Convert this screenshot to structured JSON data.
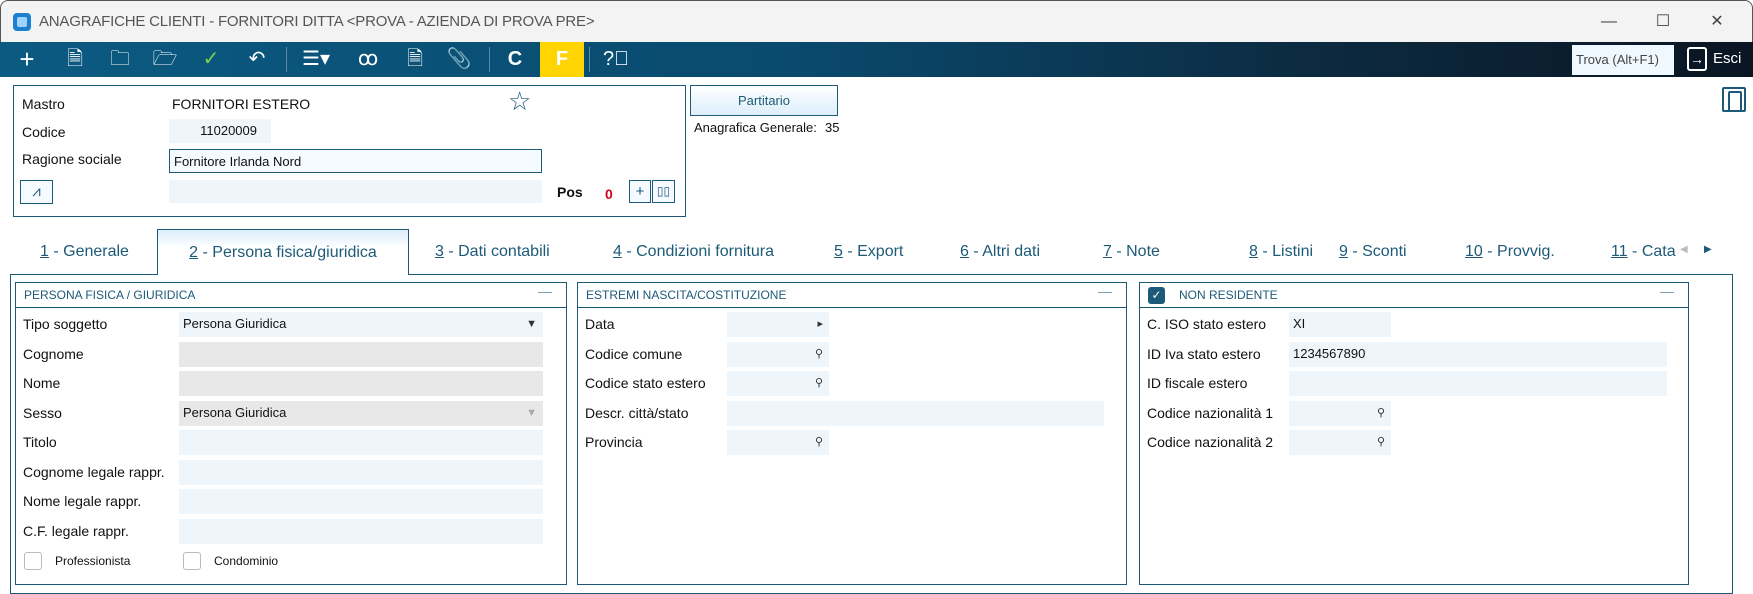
{
  "window": {
    "title": "ANAGRAFICHE CLIENTI - FORNITORI DITTA <PROVA - AZIENDA DI PROVA PRE>",
    "minimize": "—",
    "maximize": "☐",
    "close": "✕"
  },
  "toolbar": {
    "icons": [
      "plus-icon",
      "document-icon",
      "folder-open-icon",
      "folder-clock-icon",
      "check-icon",
      "undo-icon",
      "menu-dropdown-icon",
      "contacts-icon",
      "report-icon",
      "paperclip-icon",
      "c-icon",
      "f-icon",
      "help-icon"
    ],
    "c_label": "C",
    "f_label": "F",
    "search_label": "Trova (Alt+F1)",
    "exit_label": "Esci",
    "f_color": "#ffd400"
  },
  "header": {
    "mastro_label": "Mastro",
    "mastro_value": "FORNITORI ESTERO",
    "codice_label": "Codice",
    "codice_value": "11020009",
    "ragione_label": "Ragione sociale",
    "ragione_value": "Fornitore Irlanda Nord",
    "pos_label": "Pos",
    "pos_value": "0",
    "partitario_label": "Partitario",
    "anagrafica_label": "Anagrafica Generale:",
    "anagrafica_value": "35"
  },
  "tabs": [
    {
      "key": "1",
      "label": " - Generale"
    },
    {
      "key": "2",
      "label": " - Persona fisica/giuridica",
      "active": true
    },
    {
      "key": "3",
      "label": " - Dati contabili"
    },
    {
      "key": "4",
      "label": " - Condizioni fornitura"
    },
    {
      "key": "5",
      "label": " - Export"
    },
    {
      "key": "6",
      "label": " - Altri dati"
    },
    {
      "key": "7",
      "label": " - Note"
    },
    {
      "key": "8",
      "label": " - Listini"
    },
    {
      "key": "9",
      "label": " - Sconti"
    },
    {
      "key": "10",
      "label": " - Provvig."
    },
    {
      "key": "11",
      "label": " - Cata"
    }
  ],
  "panel_persona": {
    "title": "PERSONA FISICA / GIURIDICA",
    "rows": [
      {
        "label": "Tipo soggetto",
        "value": "Persona Giuridica"
      },
      {
        "label": "Cognome",
        "value": ""
      },
      {
        "label": "Nome",
        "value": ""
      },
      {
        "label": "Sesso",
        "value": "Persona Giuridica"
      },
      {
        "label": "Titolo",
        "value": ""
      },
      {
        "label": "Cognome legale rappr.",
        "value": ""
      },
      {
        "label": "Nome legale rappr.",
        "value": ""
      },
      {
        "label": "C.F. legale rappr.",
        "value": ""
      }
    ],
    "professionista": "Professionista",
    "condominio": "Condominio"
  },
  "panel_nascita": {
    "title": "ESTREMI NASCITA/COSTITUZIONE",
    "rows": [
      {
        "label": "Data",
        "value": ""
      },
      {
        "label": "Codice comune",
        "value": ""
      },
      {
        "label": "Codice stato estero",
        "value": ""
      },
      {
        "label": "Descr. città/stato",
        "value": ""
      },
      {
        "label": "Provincia",
        "value": ""
      }
    ]
  },
  "panel_nonres": {
    "title": "NON RESIDENTE",
    "checked": true,
    "rows": [
      {
        "label": "C. ISO stato estero",
        "value": "XI"
      },
      {
        "label": "ID Iva stato estero",
        "value": "1234567890"
      },
      {
        "label": "ID fiscale estero",
        "value": ""
      },
      {
        "label": "Codice nazionalità 1",
        "value": ""
      },
      {
        "label": "Codice nazionalità 2",
        "value": ""
      }
    ]
  }
}
